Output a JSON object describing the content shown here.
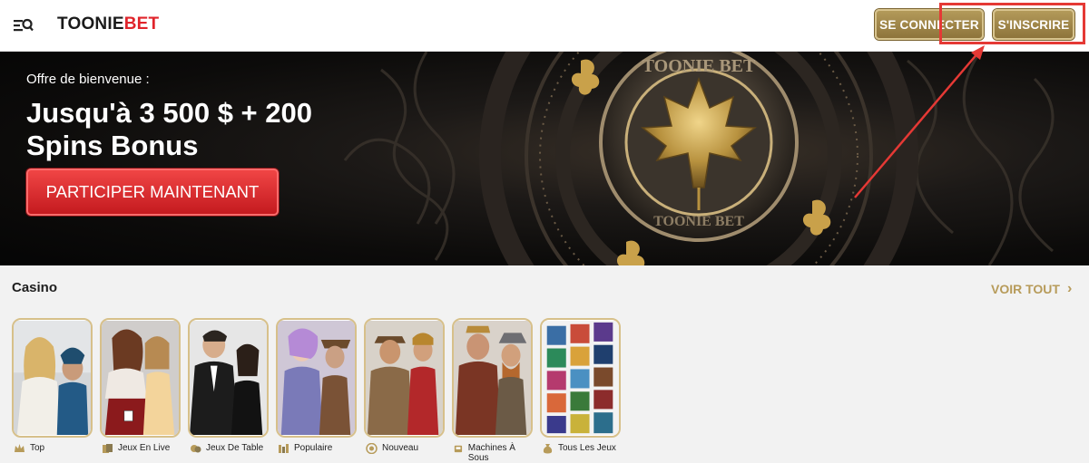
{
  "header": {
    "logo_main": "TOONIE",
    "logo_accent": "BET",
    "menu_icon": "menu-search-icon",
    "login_label": "SE CONNECTER",
    "register_label": "S'INSCRIRE"
  },
  "banner": {
    "offer_label": "Offre de bienvenue :",
    "offer_title": "Jusqu'à 3 500 $ + 200 Spins Bonus",
    "cta_label": "PARTICIPER MAINTENANT",
    "coin_text_top": "TOONIE BET",
    "coin_text_bottom": "TOONIE BET"
  },
  "casino": {
    "title": "Casino",
    "see_all": "VOIR TOUT",
    "categories": [
      {
        "label": "Top",
        "icon": "crown-icon"
      },
      {
        "label": "Jeux En Live",
        "icon": "cards-icon"
      },
      {
        "label": "Jeux De Table",
        "icon": "chips-icon"
      },
      {
        "label": "Populaire",
        "icon": "trophy-icon"
      },
      {
        "label": "Nouveau",
        "icon": "new-badge-icon"
      },
      {
        "label": "Machines À Sous",
        "icon": "slot-machine-icon"
      },
      {
        "label": "Tous Les Jeux",
        "icon": "money-bag-icon"
      }
    ]
  },
  "colors": {
    "gold": "#b79b5a",
    "red_cta": "#d9282d",
    "brand_red": "#e0242b"
  }
}
